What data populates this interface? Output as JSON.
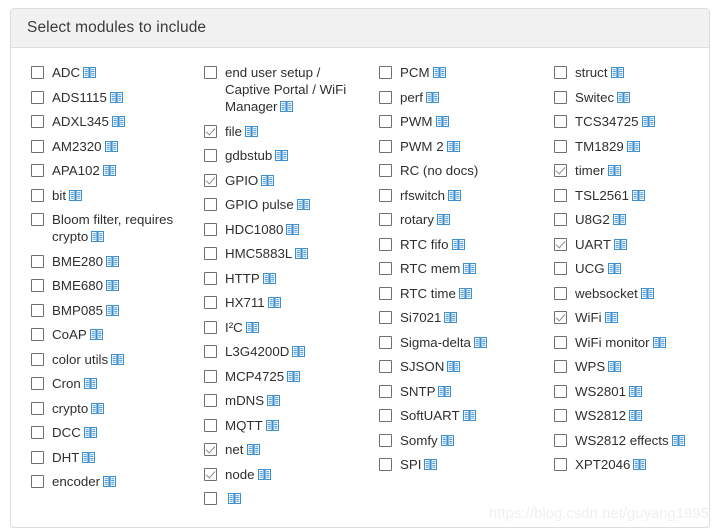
{
  "panel": {
    "title": "Select modules to include",
    "icon_name": "open-book-icon",
    "icon_color": "#3c8fd0",
    "header_bg": "#f1f1f1",
    "border_color": "#dddddd",
    "text_color": "#2f2f2f"
  },
  "watermark": "https://blog.csdn.net/guyang1995",
  "columns": [
    {
      "index": 0,
      "items": [
        {
          "label": "ADC",
          "checked": false,
          "has_doc_icon": true
        },
        {
          "label": "ADS1115",
          "checked": false,
          "has_doc_icon": true
        },
        {
          "label": "ADXL345",
          "checked": false,
          "has_doc_icon": true
        },
        {
          "label": "AM2320",
          "checked": false,
          "has_doc_icon": true
        },
        {
          "label": "APA102",
          "checked": false,
          "has_doc_icon": true
        },
        {
          "label": "bit",
          "checked": false,
          "has_doc_icon": true
        },
        {
          "label": "Bloom filter, requires crypto",
          "checked": false,
          "has_doc_icon": true
        },
        {
          "label": "BME280",
          "checked": false,
          "has_doc_icon": true
        },
        {
          "label": "BME680",
          "checked": false,
          "has_doc_icon": true
        },
        {
          "label": "BMP085",
          "checked": false,
          "has_doc_icon": true
        },
        {
          "label": "CoAP",
          "checked": false,
          "has_doc_icon": true
        },
        {
          "label": "color utils",
          "checked": false,
          "has_doc_icon": true
        },
        {
          "label": "Cron",
          "checked": false,
          "has_doc_icon": true
        },
        {
          "label": "crypto",
          "checked": false,
          "has_doc_icon": true
        },
        {
          "label": "DCC",
          "checked": false,
          "has_doc_icon": true
        },
        {
          "label": "DHT",
          "checked": false,
          "has_doc_icon": true
        },
        {
          "label": "encoder",
          "checked": false,
          "has_doc_icon": true
        }
      ]
    },
    {
      "index": 1,
      "items": [
        {
          "label": "end user setup / Captive Portal / WiFi Manager",
          "checked": false,
          "has_doc_icon": true
        },
        {
          "label": "file",
          "checked": true,
          "has_doc_icon": true
        },
        {
          "label": "gdbstub",
          "checked": false,
          "has_doc_icon": true
        },
        {
          "label": "GPIO",
          "checked": true,
          "has_doc_icon": true
        },
        {
          "label": "GPIO pulse",
          "checked": false,
          "has_doc_icon": true
        },
        {
          "label": "HDC1080",
          "checked": false,
          "has_doc_icon": true
        },
        {
          "label": "HMC5883L",
          "checked": false,
          "has_doc_icon": true
        },
        {
          "label": "HTTP",
          "checked": false,
          "has_doc_icon": true
        },
        {
          "label": "HX711",
          "checked": false,
          "has_doc_icon": true
        },
        {
          "label": "I²C",
          "checked": false,
          "has_doc_icon": true
        },
        {
          "label": "L3G4200D",
          "checked": false,
          "has_doc_icon": true
        },
        {
          "label": "MCP4725",
          "checked": false,
          "has_doc_icon": true
        },
        {
          "label": "mDNS",
          "checked": false,
          "has_doc_icon": true
        },
        {
          "label": "MQTT",
          "checked": false,
          "has_doc_icon": true
        },
        {
          "label": "net",
          "checked": true,
          "has_doc_icon": true
        },
        {
          "label": "node",
          "checked": true,
          "has_doc_icon": true
        },
        {
          "label": "",
          "checked": false,
          "has_doc_icon": true
        }
      ]
    },
    {
      "index": 2,
      "items": [
        {
          "label": "PCM",
          "checked": false,
          "has_doc_icon": true
        },
        {
          "label": "perf",
          "checked": false,
          "has_doc_icon": true
        },
        {
          "label": "PWM",
          "checked": false,
          "has_doc_icon": true
        },
        {
          "label": "PWM 2",
          "checked": false,
          "has_doc_icon": true
        },
        {
          "label": "RC (no docs)",
          "checked": false,
          "has_doc_icon": false
        },
        {
          "label": "rfswitch",
          "checked": false,
          "has_doc_icon": true
        },
        {
          "label": "rotary",
          "checked": false,
          "has_doc_icon": true
        },
        {
          "label": "RTC fifo",
          "checked": false,
          "has_doc_icon": true
        },
        {
          "label": "RTC mem",
          "checked": false,
          "has_doc_icon": true
        },
        {
          "label": "RTC time",
          "checked": false,
          "has_doc_icon": true
        },
        {
          "label": "Si7021",
          "checked": false,
          "has_doc_icon": true
        },
        {
          "label": "Sigma-delta",
          "checked": false,
          "has_doc_icon": true
        },
        {
          "label": "SJSON",
          "checked": false,
          "has_doc_icon": true
        },
        {
          "label": "SNTP",
          "checked": false,
          "has_doc_icon": true
        },
        {
          "label": "SoftUART",
          "checked": false,
          "has_doc_icon": true
        },
        {
          "label": "Somfy",
          "checked": false,
          "has_doc_icon": true
        },
        {
          "label": "SPI",
          "checked": false,
          "has_doc_icon": true
        }
      ]
    },
    {
      "index": 3,
      "items": [
        {
          "label": "struct",
          "checked": false,
          "has_doc_icon": true
        },
        {
          "label": "Switec",
          "checked": false,
          "has_doc_icon": true
        },
        {
          "label": "TCS34725",
          "checked": false,
          "has_doc_icon": true
        },
        {
          "label": "TM1829",
          "checked": false,
          "has_doc_icon": true
        },
        {
          "label": "timer",
          "checked": true,
          "has_doc_icon": true
        },
        {
          "label": "TSL2561",
          "checked": false,
          "has_doc_icon": true
        },
        {
          "label": "U8G2",
          "checked": false,
          "has_doc_icon": true
        },
        {
          "label": "UART",
          "checked": true,
          "has_doc_icon": true
        },
        {
          "label": "UCG",
          "checked": false,
          "has_doc_icon": true
        },
        {
          "label": "websocket",
          "checked": false,
          "has_doc_icon": true
        },
        {
          "label": "WiFi",
          "checked": true,
          "has_doc_icon": true
        },
        {
          "label": "WiFi monitor",
          "checked": false,
          "has_doc_icon": true
        },
        {
          "label": "WPS",
          "checked": false,
          "has_doc_icon": true
        },
        {
          "label": "WS2801",
          "checked": false,
          "has_doc_icon": true
        },
        {
          "label": "WS2812",
          "checked": false,
          "has_doc_icon": true
        },
        {
          "label": "WS2812 effects",
          "checked": false,
          "has_doc_icon": true
        },
        {
          "label": "XPT2046",
          "checked": false,
          "has_doc_icon": true
        }
      ]
    }
  ]
}
